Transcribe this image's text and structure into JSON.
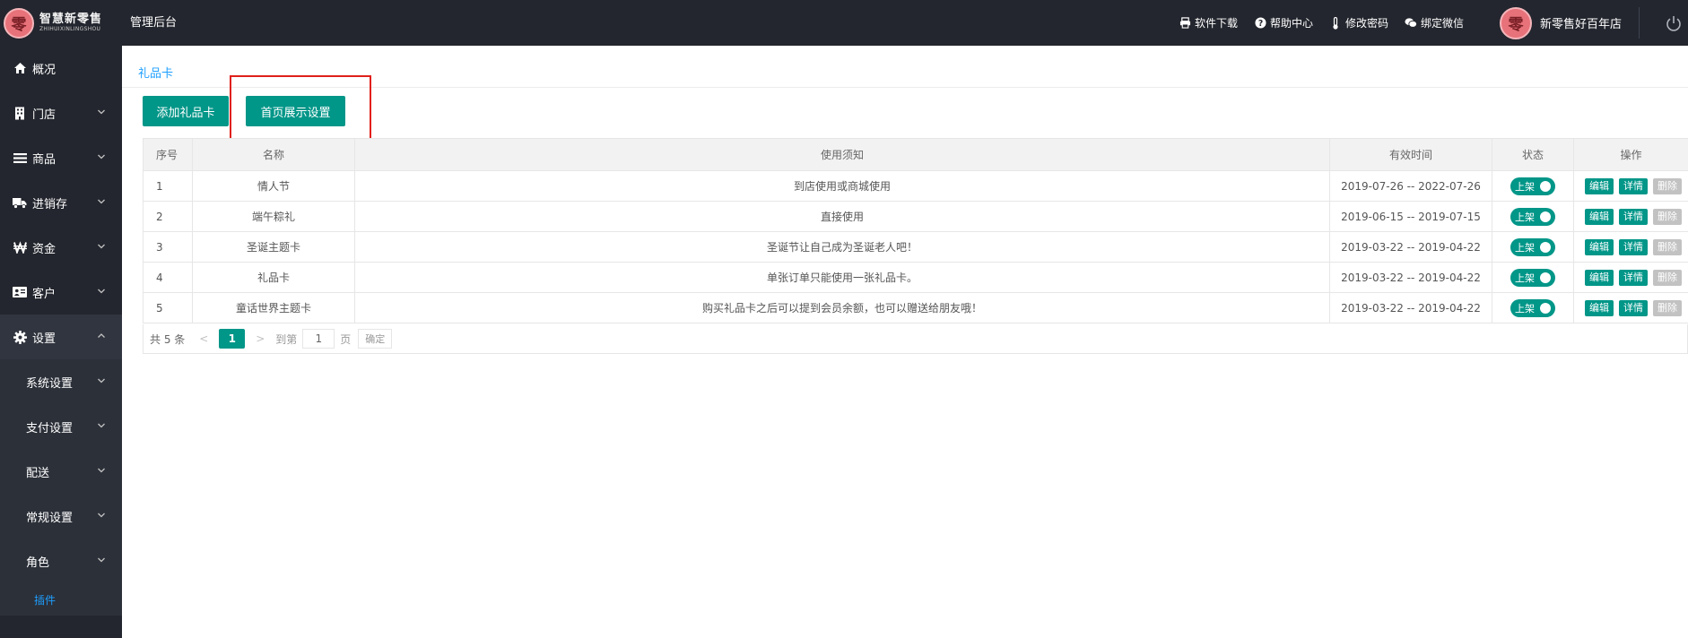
{
  "app": {
    "logo_char": "零",
    "logo_name": "智慧新零售",
    "logo_subtitle": "ZHIHUIXINLINGSHOU",
    "admin_title": "管理后台"
  },
  "top_links": [
    {
      "label": "软件下载",
      "icon": "printer-icon"
    },
    {
      "label": "帮助中心",
      "icon": "question-icon"
    },
    {
      "label": "修改密码",
      "icon": "thermometer-icon"
    },
    {
      "label": "绑定微信",
      "icon": "wechat-icon"
    }
  ],
  "user": {
    "avatar_char": "零",
    "name": "新零售好百年店"
  },
  "sidebar": {
    "items": [
      {
        "label": "概况",
        "icon": "home-icon"
      },
      {
        "label": "门店",
        "icon": "building-icon"
      },
      {
        "label": "商品",
        "icon": "list-icon"
      },
      {
        "label": "进销存",
        "icon": "truck-icon"
      },
      {
        "label": "资金",
        "icon": "won-icon"
      },
      {
        "label": "客户",
        "icon": "id-card-icon"
      },
      {
        "label": "设置",
        "icon": "gear-icon"
      }
    ],
    "settings_sub": [
      {
        "label": "系统设置"
      },
      {
        "label": "支付设置"
      },
      {
        "label": "配送"
      },
      {
        "label": "常规设置"
      },
      {
        "label": "角色"
      }
    ],
    "active_sub": "插件"
  },
  "main": {
    "breadcrumb": "礼品卡",
    "add_button": "添加礼品卡",
    "home_display_button": "首页展示设置",
    "table": {
      "headers": [
        "序号",
        "名称",
        "使用须知",
        "有效时间",
        "状态",
        "操作"
      ],
      "rows": [
        {
          "no": "1",
          "name": "情人节",
          "notice": "到店使用或商城使用",
          "validity": "2019-07-26 -- 2022-07-26",
          "status": "上架"
        },
        {
          "no": "2",
          "name": "端午粽礼",
          "notice": "直接使用",
          "validity": "2019-06-15 -- 2019-07-15",
          "status": "上架"
        },
        {
          "no": "3",
          "name": "圣诞主题卡",
          "notice": "圣诞节让自己成为圣诞老人吧！",
          "validity": "2019-03-22 -- 2019-04-22",
          "status": "上架"
        },
        {
          "no": "4",
          "name": "礼品卡",
          "notice": "单张订单只能使用一张礼品卡。",
          "validity": "2019-03-22 -- 2019-04-22",
          "status": "上架"
        },
        {
          "no": "5",
          "name": "童话世界主题卡",
          "notice": "购买礼品卡之后可以提到会员余额，也可以赠送给朋友哦！",
          "validity": "2019-03-22 -- 2019-04-22",
          "status": "上架"
        }
      ],
      "actions": {
        "edit": "编辑",
        "detail": "详情",
        "delete": "删除"
      }
    },
    "pagination": {
      "total": "共 5 条",
      "prev": "<",
      "current": "1",
      "next": ">",
      "goto_label": "到第",
      "page_value": "1",
      "page_unit": "页",
      "confirm": "确定"
    }
  }
}
